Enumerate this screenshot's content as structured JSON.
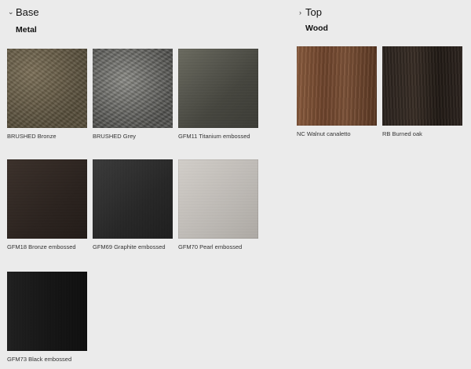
{
  "base": {
    "title": "Base",
    "chevron": "chevron-down-icon",
    "category": "Metal",
    "swatches": [
      {
        "label": "BRUSHED Bronze"
      },
      {
        "label": "BRUSHED Grey"
      },
      {
        "label": "GFM11 Titanium embossed"
      },
      {
        "label": "GFM18 Bronze embossed"
      },
      {
        "label": "GFM69 Graphite embossed"
      },
      {
        "label": "GFM70 Pearl embossed"
      },
      {
        "label": "GFM73 Black embossed"
      }
    ]
  },
  "top": {
    "title": "Top",
    "chevron": "chevron-right-icon",
    "category": "Wood",
    "swatches": [
      {
        "label": "NC Walnut canaletto"
      },
      {
        "label": "RB Burned oak"
      }
    ]
  }
}
